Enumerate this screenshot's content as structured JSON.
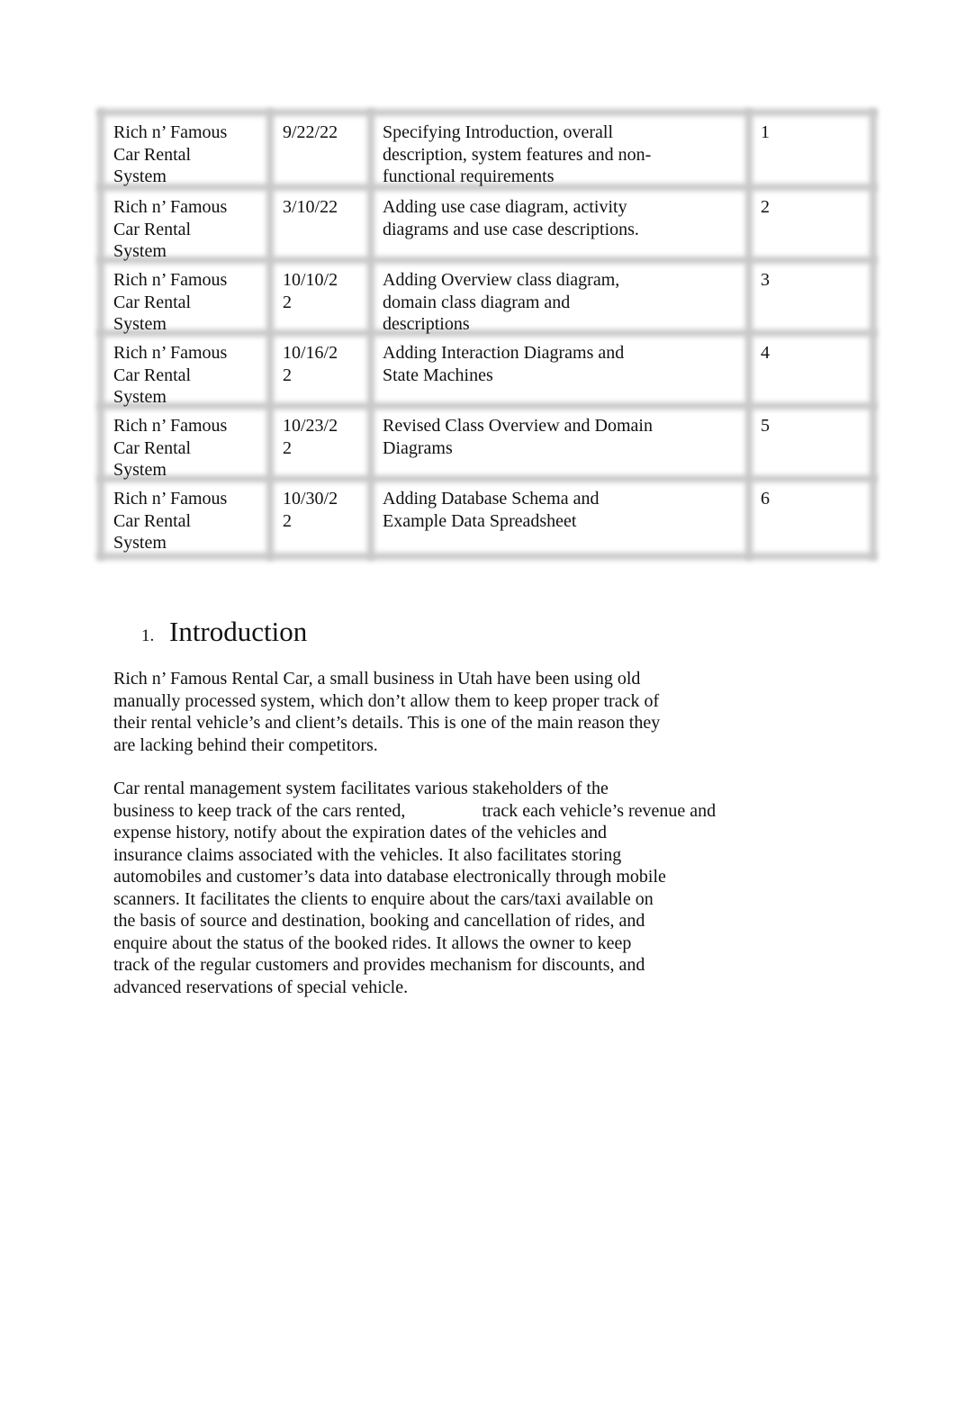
{
  "revision_table": {
    "rows": [
      {
        "name": [
          "Rich n’ Famous",
          "Car Rental",
          "System"
        ],
        "date": [
          "9/22/22"
        ],
        "description": [
          "Specifying Introduction, overall",
          "description, system features and non-",
          "functional requirements"
        ],
        "version": "1"
      },
      {
        "name": [
          "Rich n’ Famous",
          "Car Rental",
          "System"
        ],
        "date": [
          "3/10/22"
        ],
        "description": [
          "Adding use case diagram, activity",
          "diagrams and use case descriptions."
        ],
        "version": "2"
      },
      {
        "name": [
          "Rich n’ Famous",
          "Car Rental",
          "System"
        ],
        "date": [
          "10/10/2",
          "2"
        ],
        "description": [
          "Adding Overview class diagram,",
          "domain class diagram and",
          "descriptions"
        ],
        "version": "3"
      },
      {
        "name": [
          "Rich n’ Famous",
          "Car Rental",
          "System"
        ],
        "date": [
          "10/16/2",
          "2"
        ],
        "description": [
          "Adding Interaction Diagrams and",
          "State Machines"
        ],
        "version": "4"
      },
      {
        "name": [
          "Rich n’ Famous",
          "Car Rental",
          "System"
        ],
        "date": [
          "10/23/2",
          "2"
        ],
        "description": [
          "Revised Class Overview and Domain",
          "Diagrams"
        ],
        "version": "5"
      },
      {
        "name": [
          "Rich n’ Famous",
          "Car Rental",
          "System"
        ],
        "date": [
          "10/30/2",
          "2"
        ],
        "description": [
          "Adding Database Schema and",
          "Example Data Spreadsheet"
        ],
        "version": "6"
      }
    ]
  },
  "section": {
    "number": "1.",
    "title": "Introduction",
    "paragraphs": [
      [
        "Rich n’ Famous Rental Car, a small business in Utah have been using old",
        "manually processed system, which don’t allow them to keep proper track of",
        "their rental vehicle’s and client’s details. This is one of the main reason they",
        "are lacking behind their competitors."
      ],
      [
        "Car rental management system facilitates various stakeholders of the",
        "business to keep track of the cars rented,                 track each vehicle’s revenue and",
        "expense history, notify about the expiration dates of the vehicles and",
        "insurance claims associated with the vehicles. It also facilitates storing",
        "automobiles and customer’s data into database electronically through mobile",
        "scanners. It facilitates the clients to enquire about the cars/taxi available on",
        "the basis of source and destination, booking and cancellation of rides, and",
        "enquire about the status of the booked rides. It allows the owner to keep",
        "track of the regular customers and provides mechanism for discounts, and",
        "advanced reservations of special vehicle."
      ]
    ]
  }
}
